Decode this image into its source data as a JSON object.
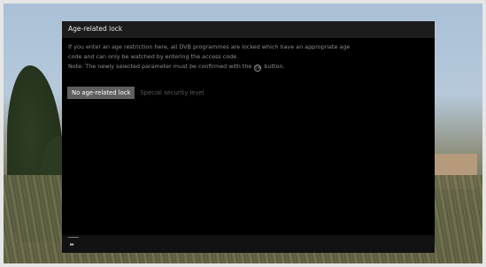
{
  "menu": {
    "title": "Age-related lock",
    "description_line1": "If you enter an age restriction here, all DVB programmes are locked which have an appropriate age",
    "description_line2": "code and can only be watched by entering the access code.",
    "note_prefix": "Note: The newly selected parameter must be confirmed with the",
    "note_button_glyph": "OK",
    "note_suffix": "button.",
    "options": [
      {
        "label": "No age-related lock",
        "selected": true
      },
      {
        "label": "Special security level",
        "selected": false
      }
    ],
    "footer_glyph": "▸▸"
  },
  "colors": {
    "panel_bg": "#000000",
    "header_bg": "#1c1c1c",
    "selected_bg": "#5f5f5f",
    "text_primary": "#e6e6e6",
    "text_dim": "#8f8f8f"
  }
}
